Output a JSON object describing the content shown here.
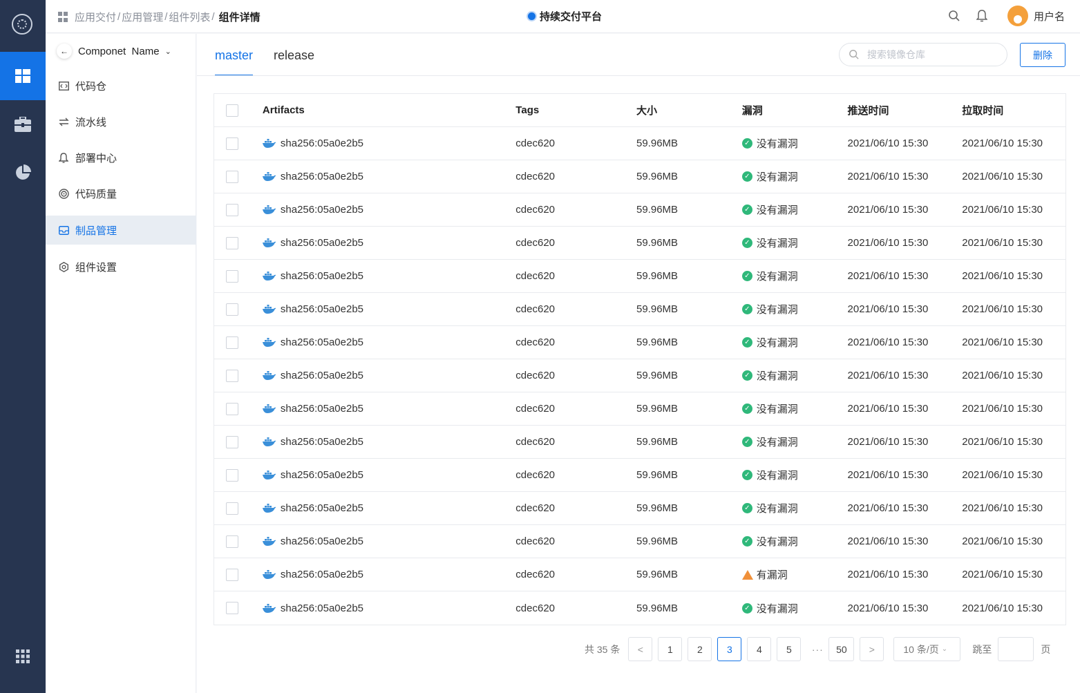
{
  "header": {
    "breadcrumb": [
      "应用交付",
      "应用管理",
      "组件列表"
    ],
    "breadcrumb_separator": "/",
    "breadcrumb_current": "组件详情",
    "platform_title": "持续交付平台",
    "username": "用户名"
  },
  "rail": {
    "items": [
      "logo-icon",
      "dashboard-icon",
      "toolbox-icon",
      "pie-chart-icon",
      "apps-grid-icon"
    ],
    "active_color": "#1473e6",
    "bg_color": "#273550"
  },
  "sidebar": {
    "component_name": "Componet  Name",
    "items": [
      {
        "label": "代码仓",
        "icon": "code-repo-icon"
      },
      {
        "label": "流水线",
        "icon": "pipeline-icon"
      },
      {
        "label": "部署中心",
        "icon": "bell-deploy-icon"
      },
      {
        "label": "代码质量",
        "icon": "quality-icon"
      },
      {
        "label": "制品管理",
        "icon": "artifact-icon",
        "active": true
      },
      {
        "label": "组件设置",
        "icon": "settings-icon"
      }
    ]
  },
  "tabs": [
    {
      "label": "master",
      "active": true
    },
    {
      "label": "release",
      "active": false
    }
  ],
  "search": {
    "placeholder": "搜索镜像仓库",
    "value": ""
  },
  "delete_button": "删除",
  "table": {
    "columns": [
      "Artifacts",
      "Tags",
      "大小",
      "漏洞",
      "推送时间",
      "拉取时间"
    ],
    "rows": [
      {
        "artifact": "sha256:05a0e2b5",
        "tag": "cdec620",
        "size": "59.96MB",
        "vuln": "没有漏洞",
        "vuln_status": "ok",
        "push": "2021/06/10 15:30",
        "pull": "2021/06/10 15:30"
      },
      {
        "artifact": "sha256:05a0e2b5",
        "tag": "cdec620",
        "size": "59.96MB",
        "vuln": "没有漏洞",
        "vuln_status": "ok",
        "push": "2021/06/10 15:30",
        "pull": "2021/06/10 15:30"
      },
      {
        "artifact": "sha256:05a0e2b5",
        "tag": "cdec620",
        "size": "59.96MB",
        "vuln": "没有漏洞",
        "vuln_status": "ok",
        "push": "2021/06/10 15:30",
        "pull": "2021/06/10 15:30"
      },
      {
        "artifact": "sha256:05a0e2b5",
        "tag": "cdec620",
        "size": "59.96MB",
        "vuln": "没有漏洞",
        "vuln_status": "ok",
        "push": "2021/06/10 15:30",
        "pull": "2021/06/10 15:30"
      },
      {
        "artifact": "sha256:05a0e2b5",
        "tag": "cdec620",
        "size": "59.96MB",
        "vuln": "没有漏洞",
        "vuln_status": "ok",
        "push": "2021/06/10 15:30",
        "pull": "2021/06/10 15:30"
      },
      {
        "artifact": "sha256:05a0e2b5",
        "tag": "cdec620",
        "size": "59.96MB",
        "vuln": "没有漏洞",
        "vuln_status": "ok",
        "push": "2021/06/10 15:30",
        "pull": "2021/06/10 15:30"
      },
      {
        "artifact": "sha256:05a0e2b5",
        "tag": "cdec620",
        "size": "59.96MB",
        "vuln": "没有漏洞",
        "vuln_status": "ok",
        "push": "2021/06/10 15:30",
        "pull": "2021/06/10 15:30"
      },
      {
        "artifact": "sha256:05a0e2b5",
        "tag": "cdec620",
        "size": "59.96MB",
        "vuln": "没有漏洞",
        "vuln_status": "ok",
        "push": "2021/06/10 15:30",
        "pull": "2021/06/10 15:30"
      },
      {
        "artifact": "sha256:05a0e2b5",
        "tag": "cdec620",
        "size": "59.96MB",
        "vuln": "没有漏洞",
        "vuln_status": "ok",
        "push": "2021/06/10 15:30",
        "pull": "2021/06/10 15:30"
      },
      {
        "artifact": "sha256:05a0e2b5",
        "tag": "cdec620",
        "size": "59.96MB",
        "vuln": "没有漏洞",
        "vuln_status": "ok",
        "push": "2021/06/10 15:30",
        "pull": "2021/06/10 15:30"
      },
      {
        "artifact": "sha256:05a0e2b5",
        "tag": "cdec620",
        "size": "59.96MB",
        "vuln": "没有漏洞",
        "vuln_status": "ok",
        "push": "2021/06/10 15:30",
        "pull": "2021/06/10 15:30"
      },
      {
        "artifact": "sha256:05a0e2b5",
        "tag": "cdec620",
        "size": "59.96MB",
        "vuln": "没有漏洞",
        "vuln_status": "ok",
        "push": "2021/06/10 15:30",
        "pull": "2021/06/10 15:30"
      },
      {
        "artifact": "sha256:05a0e2b5",
        "tag": "cdec620",
        "size": "59.96MB",
        "vuln": "没有漏洞",
        "vuln_status": "ok",
        "push": "2021/06/10 15:30",
        "pull": "2021/06/10 15:30"
      },
      {
        "artifact": "sha256:05a0e2b5",
        "tag": "cdec620",
        "size": "59.96MB",
        "vuln": "有漏洞",
        "vuln_status": "warn",
        "push": "2021/06/10 15:30",
        "pull": "2021/06/10 15:30"
      },
      {
        "artifact": "sha256:05a0e2b5",
        "tag": "cdec620",
        "size": "59.96MB",
        "vuln": "没有漏洞",
        "vuln_status": "ok",
        "push": "2021/06/10 15:30",
        "pull": "2021/06/10 15:30"
      }
    ]
  },
  "pagination": {
    "total_text": "共 35 条",
    "pages": [
      "1",
      "2",
      "3",
      "4",
      "5"
    ],
    "current": "3",
    "ellipsis": "···",
    "last_page": "50",
    "prev": "<",
    "next": ">",
    "page_size": "10 条/页",
    "jump_label": "跳至",
    "page_label": "页"
  },
  "colors": {
    "accent": "#1473e6",
    "ok": "#2fb87a",
    "warn": "#f0903a"
  }
}
